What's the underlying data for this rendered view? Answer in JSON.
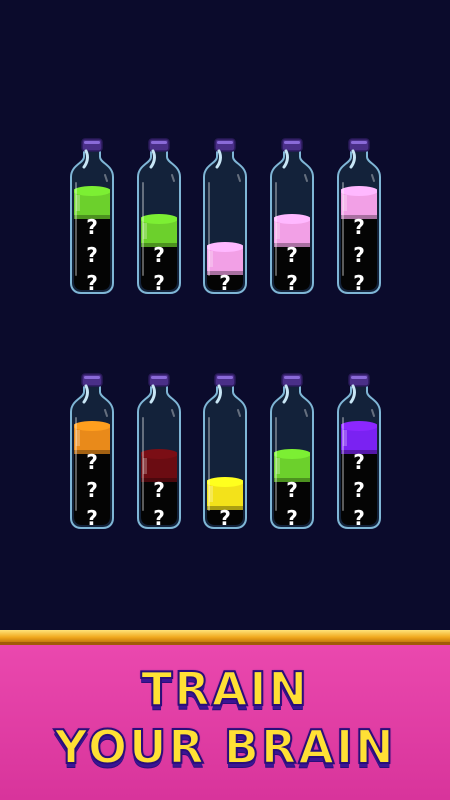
{
  "board": {
    "rows": [
      {
        "bottles": [
          {
            "top_color": "#6cd02c",
            "unknown_count": 3
          },
          {
            "top_color": "#6cd02c",
            "unknown_count": 2
          },
          {
            "top_color": "#f2a0e6",
            "unknown_count": 1
          },
          {
            "top_color": "#f2a0e6",
            "unknown_count": 2
          },
          {
            "top_color": "#f2a0e6",
            "unknown_count": 3
          }
        ]
      },
      {
        "bottles": [
          {
            "top_color": "#e98a1a",
            "unknown_count": 3
          },
          {
            "top_color": "#6b0c12",
            "unknown_count": 2
          },
          {
            "top_color": "#f3e21a",
            "unknown_count": 1
          },
          {
            "top_color": "#6cd02c",
            "unknown_count": 2
          },
          {
            "top_color": "#7a22f2",
            "unknown_count": 3
          }
        ]
      }
    ],
    "unknown_symbol": "?"
  },
  "banner": {
    "line1": "TRAIN",
    "line2": "YOUR BRAIN"
  },
  "colors": {
    "background": "#0b0b2c",
    "banner_pink": "#e13fa7",
    "banner_gold": "#f0a91e",
    "headline_yellow": "#ffe035",
    "headline_outline": "#2a0e7a"
  }
}
